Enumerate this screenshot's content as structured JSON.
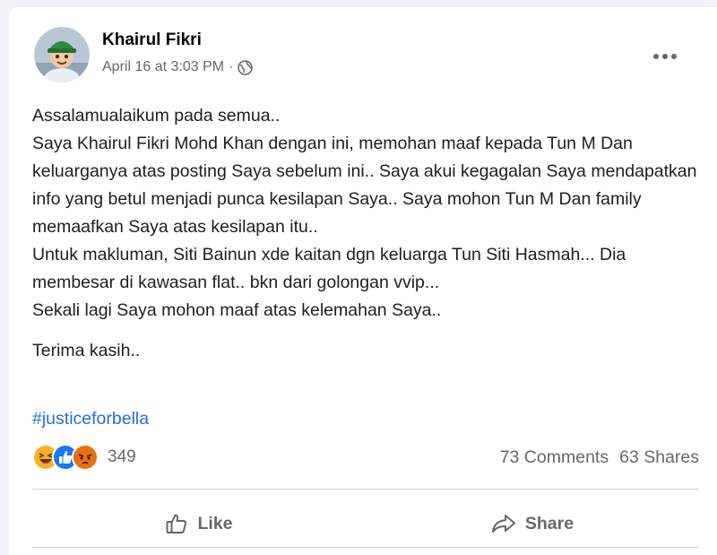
{
  "post": {
    "author": "Khairul Fikri",
    "timestamp": "April 16 at 3:03 PM",
    "separator": "·",
    "privacy_icon": "globe-icon",
    "more_icon": "more-options-icon",
    "paragraphs": [
      "Assalamualaikum pada semua..",
      "Saya Khairul Fikri Mohd Khan dengan ini, memohan maaf kepada Tun M Dan keluarganya atas posting Saya sebelum ini.. Saya akui kegagalan Saya mendapatkan info yang betul menjadi punca kesilapan Saya.. Saya mohon Tun M Dan family memaafkan Saya atas kesilapan itu..",
      "Untuk makluman, Siti Bainun xde kaitan dgn keluarga Tun Siti Hasmah... Dia membesar di kawasan flat.. bkn dari golongan vvip...",
      "Sekali lagi Saya mohon maaf atas kelemahan Saya..",
      "Terima kasih.."
    ],
    "hashtag": "#justiceforbella"
  },
  "stats": {
    "reaction_icons": [
      "haha-reaction-icon",
      "like-reaction-icon",
      "angry-reaction-icon"
    ],
    "reaction_count": "349",
    "comments": "73 Comments",
    "shares": "63 Shares"
  },
  "actions": {
    "like_label": "Like",
    "share_label": "Share"
  },
  "colors": {
    "hashtag": "#216fdb",
    "secondary_text": "#65676b",
    "like_blue": "#1877f2",
    "angry_orange": "#e9710f",
    "haha_yellow": "#f7b125"
  }
}
